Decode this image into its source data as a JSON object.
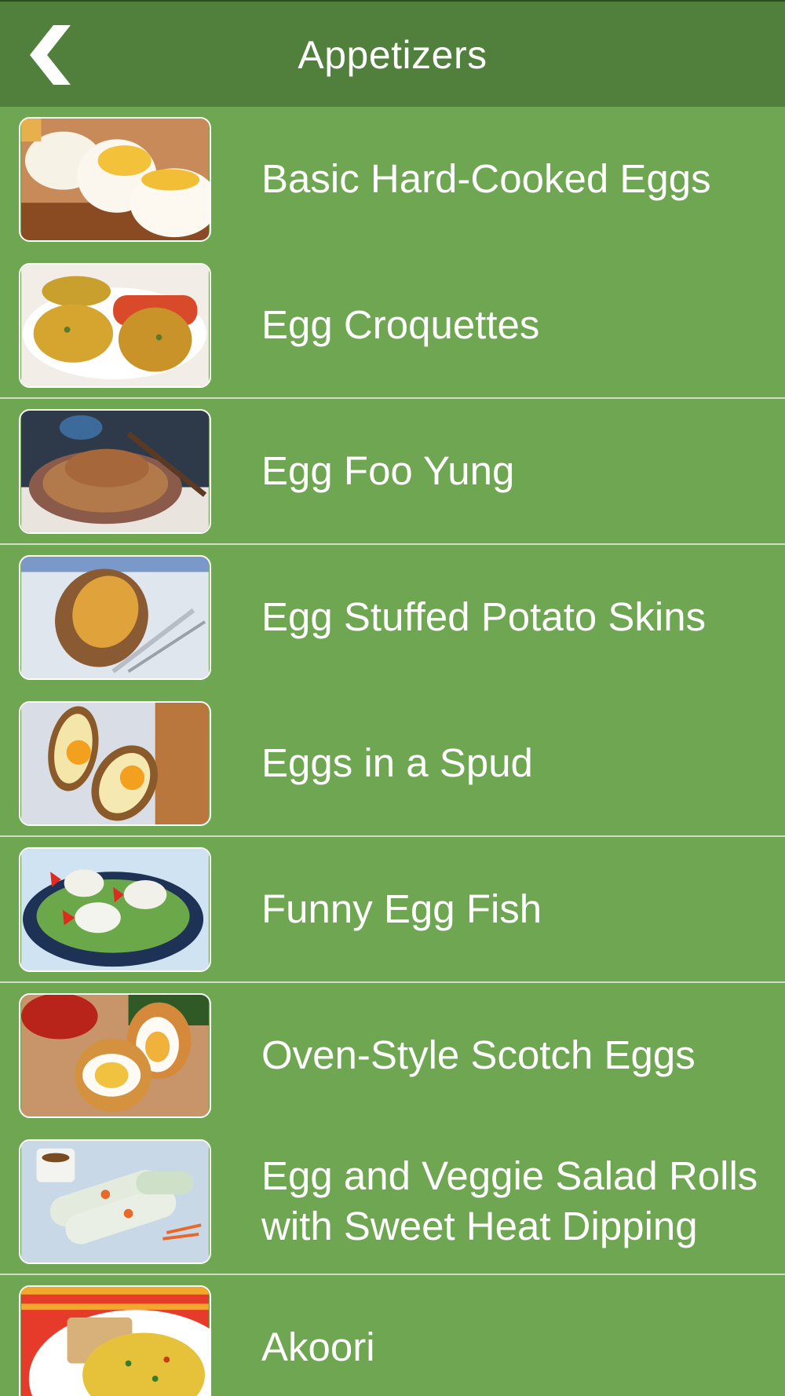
{
  "header": {
    "title": "Appetizers",
    "back_icon": "chevron-left-icon"
  },
  "colors": {
    "nav_bar": "#517f3c",
    "list_background": "#6fa651",
    "separator": "#cfdcc6",
    "text": "#ffffff"
  },
  "recipes": [
    {
      "name": "Basic Hard-Cooked Eggs",
      "image": "hard-cooked-eggs-photo"
    },
    {
      "name": "Egg Croquettes",
      "image": "egg-croquettes-photo"
    },
    {
      "name": "Egg Foo Yung",
      "image": "egg-foo-yung-photo"
    },
    {
      "name": "Egg Stuffed Potato Skins",
      "image": "stuffed-potato-skins-photo"
    },
    {
      "name": "Eggs in a Spud",
      "image": "eggs-in-a-spud-photo"
    },
    {
      "name": "Funny Egg Fish",
      "image": "funny-egg-fish-photo"
    },
    {
      "name": "Oven-Style Scotch Eggs",
      "image": "scotch-eggs-photo"
    },
    {
      "name": "Egg and Veggie Salad Rolls\nwith Sweet Heat Dipping",
      "image": "salad-rolls-photo"
    },
    {
      "name": "Akoori",
      "image": "akoori-photo"
    }
  ]
}
